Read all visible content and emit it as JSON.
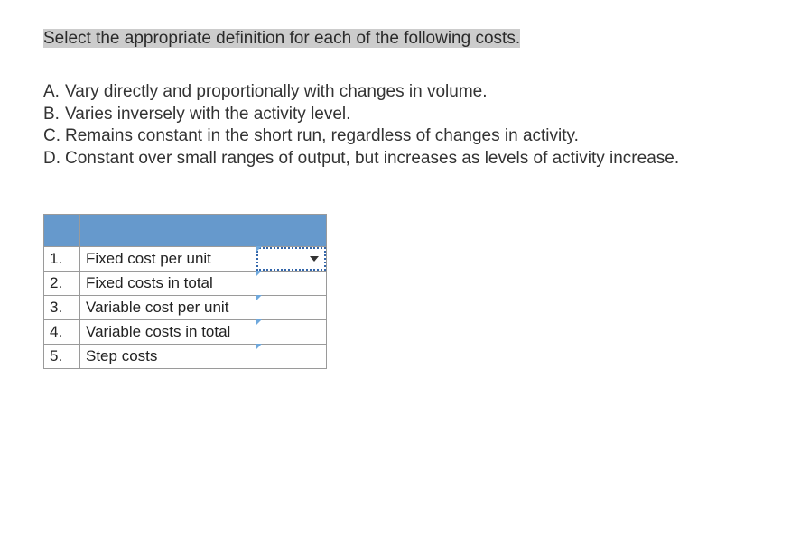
{
  "instruction": "Select the appropriate definition for each of the following costs.",
  "definitions": [
    {
      "letter": "A.",
      "text": "Vary directly and proportionally with changes in volume."
    },
    {
      "letter": "B.",
      "text": "Varies inversely with the activity level."
    },
    {
      "letter": "C.",
      "text": "Remains constant in the short run, regardless of changes in activity."
    },
    {
      "letter": "D.",
      "text": "Constant over small ranges of output, but increases as levels of activity increase."
    }
  ],
  "table": {
    "rows": [
      {
        "num": "1.",
        "label": "Fixed cost per unit",
        "answer": "",
        "active_dropdown": true
      },
      {
        "num": "2.",
        "label": "Fixed costs in total",
        "answer": "",
        "active_dropdown": false
      },
      {
        "num": "3.",
        "label": "Variable cost per unit",
        "answer": "",
        "active_dropdown": false
      },
      {
        "num": "4.",
        "label": "Variable costs in total",
        "answer": "",
        "active_dropdown": false
      },
      {
        "num": "5.",
        "label": "Step costs",
        "answer": "",
        "active_dropdown": false
      }
    ]
  }
}
